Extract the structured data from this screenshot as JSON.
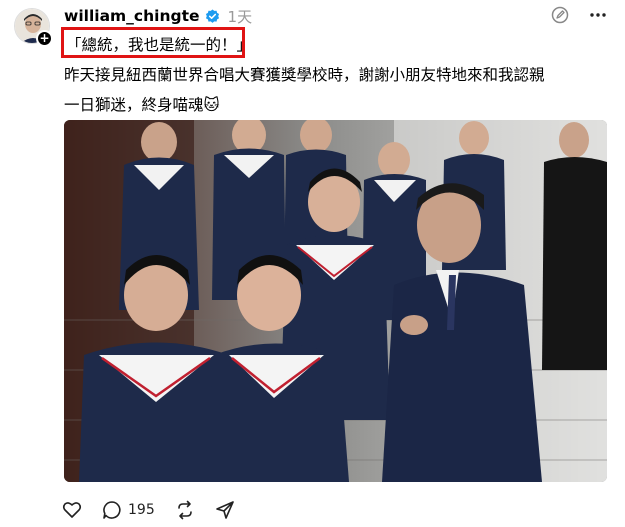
{
  "post": {
    "username": "william_chingte",
    "timestamp": "1天",
    "line1": "「總統，我也是統一的！」",
    "line2": "昨天接見紐西蘭世界合唱大賽獲獎學校時，謝謝小朋友特地來和我認親",
    "line3": "一日獅迷，終身喵魂🐱",
    "icons": {
      "avatar": "profile-photo",
      "follow": "plus-icon",
      "verified": "verified-badge-icon",
      "edit": "edit-icon",
      "more": "more-icon",
      "like": "heart-icon",
      "comment": "comment-icon",
      "repost": "repost-icon",
      "share": "send-icon"
    },
    "comment_count": "195",
    "highlight_color": "#e01414",
    "verified_color": "#1d9bf0"
  }
}
